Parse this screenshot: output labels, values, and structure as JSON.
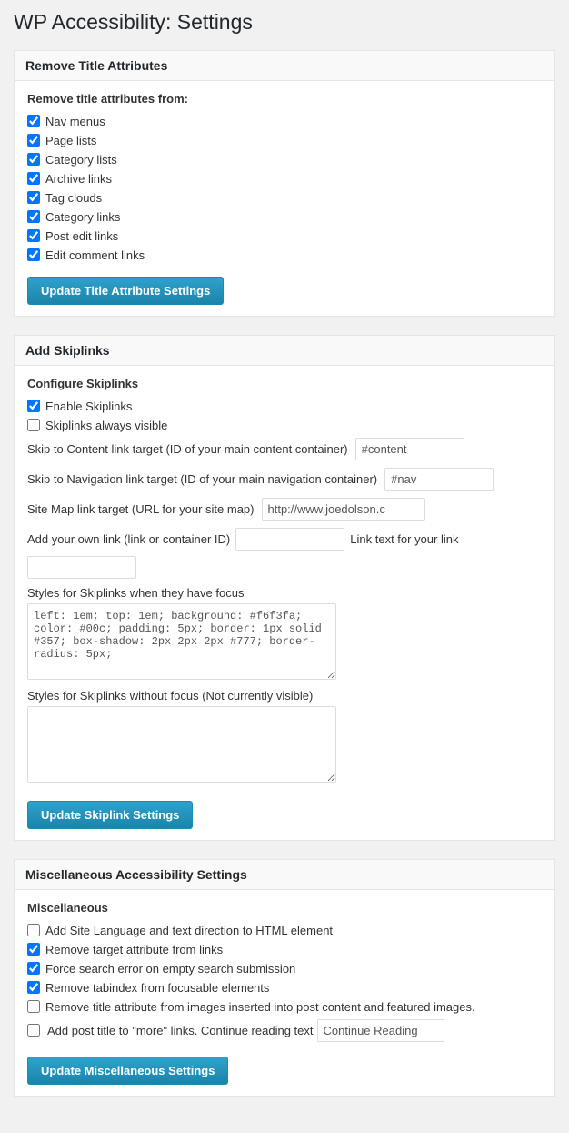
{
  "page": {
    "title": "WP Accessibility: Settings"
  },
  "remove_title_section": {
    "header": "Remove Title Attributes",
    "subheader": "Remove title attributes from:",
    "checkboxes": [
      {
        "id": "cb_nav_menus",
        "label": "Nav menus",
        "checked": true
      },
      {
        "id": "cb_page_lists",
        "label": "Page lists",
        "checked": true
      },
      {
        "id": "cb_category_lists",
        "label": "Category lists",
        "checked": true
      },
      {
        "id": "cb_archive_links",
        "label": "Archive links",
        "checked": true
      },
      {
        "id": "cb_tag_clouds",
        "label": "Tag clouds",
        "checked": true
      },
      {
        "id": "cb_category_links",
        "label": "Category links",
        "checked": true
      },
      {
        "id": "cb_post_edit_links",
        "label": "Post edit links",
        "checked": true
      },
      {
        "id": "cb_edit_comment_links",
        "label": "Edit comment links",
        "checked": true
      }
    ],
    "button_label": "Update Title Attribute Settings"
  },
  "skiplinks_section": {
    "header": "Add Skiplinks",
    "subheader": "Configure Skiplinks",
    "checkboxes": [
      {
        "id": "cb_enable_skiplinks",
        "label": "Enable Skiplinks",
        "checked": true
      },
      {
        "id": "cb_always_visible",
        "label": "Skiplinks always visible",
        "checked": false
      }
    ],
    "fields": [
      {
        "label": "Skip to Content link target (ID of your main content container)",
        "value": "#content"
      },
      {
        "label": "Skip to Navigation link target (ID of your main navigation container)",
        "value": "#nav"
      },
      {
        "label": "Site Map link target (URL for your site map)",
        "value": "http://www.joedolson.c"
      }
    ],
    "own_link_label": "Add your own link (link or container ID)",
    "own_link_value": "",
    "link_text_label": "Link text for your link",
    "link_text_value": "",
    "focus_styles_label": "Styles for Skiplinks when they have focus",
    "focus_styles_value": "left: 1em; top: 1em; background: #f6f3fa; color: #00c; padding: 5px; border: 1px solid #357; box-shadow: 2px 2px 2px #777; border-radius: 5px;",
    "no_focus_styles_label": "Styles for Skiplinks without focus (Not currently visible)",
    "no_focus_styles_value": "",
    "button_label": "Update Skiplink Settings"
  },
  "misc_section": {
    "header": "Miscellaneous Accessibility Settings",
    "subheader": "Miscellaneous",
    "checkboxes": [
      {
        "id": "cb_add_lang",
        "label": "Add Site Language and text direction to HTML element",
        "checked": false
      },
      {
        "id": "cb_remove_target",
        "label": "Remove target attribute from links",
        "checked": true
      },
      {
        "id": "cb_search_error",
        "label": "Force search error on empty search submission",
        "checked": true
      },
      {
        "id": "cb_tabindex",
        "label": "Remove tabindex from focusable elements",
        "checked": true
      },
      {
        "id": "cb_img_title",
        "label": "Remove title attribute from images inserted into post content and featured images.",
        "checked": false
      },
      {
        "id": "cb_more_links",
        "label": "Add post title to \"more\" links. Continue reading text",
        "checked": false
      }
    ],
    "continue_reading_value": "Continue Reading",
    "button_label": "Update Miscellaneous Settings"
  }
}
